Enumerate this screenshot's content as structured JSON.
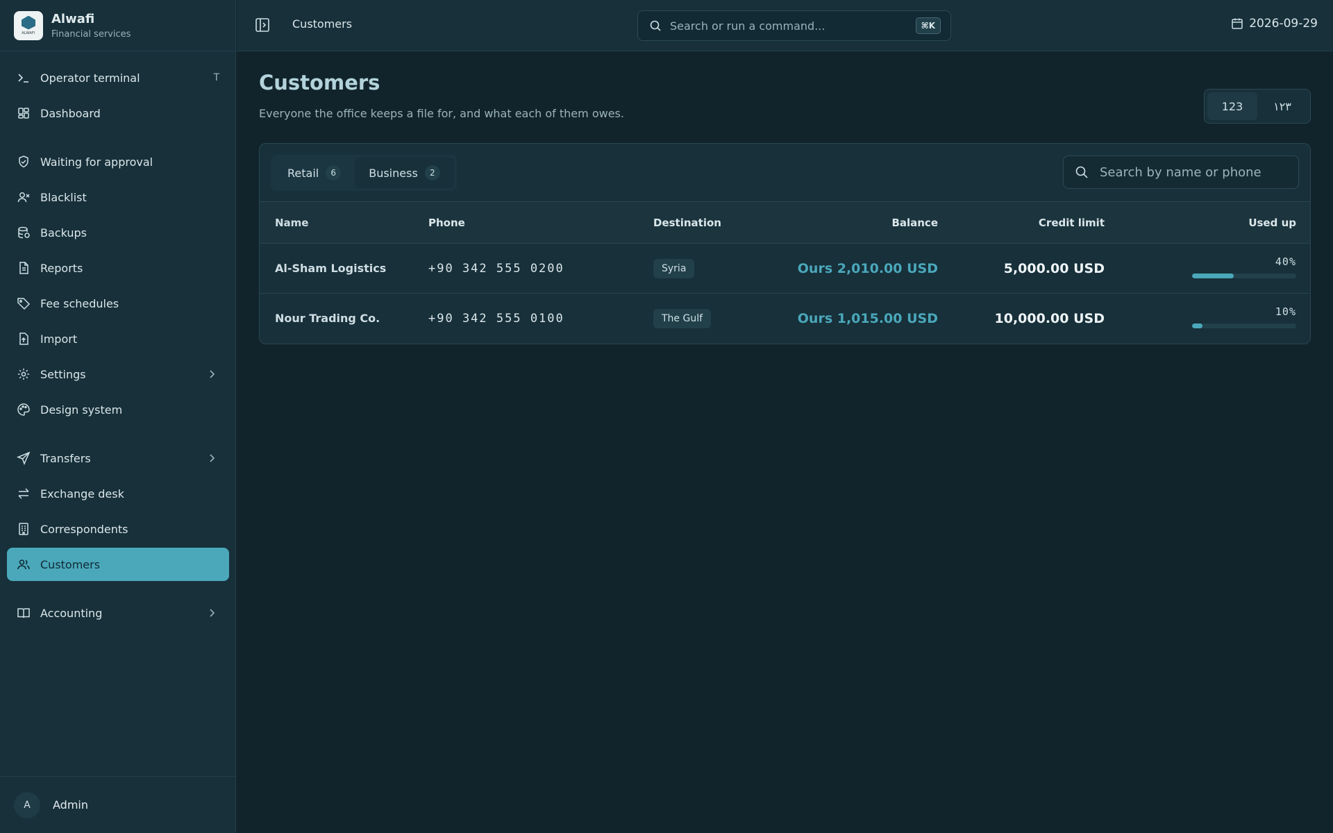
{
  "brand": {
    "name": "Alwafi",
    "subtitle": "Financial services",
    "logo_text": "ALWAFI"
  },
  "sidebar": {
    "items": [
      {
        "label": "Operator terminal",
        "icon": "terminal-icon",
        "shortcut": "T"
      },
      {
        "label": "Dashboard",
        "icon": "dashboard-icon"
      },
      {
        "label": "Waiting for approval",
        "icon": "shield-check-icon"
      },
      {
        "label": "Blacklist",
        "icon": "user-x-icon"
      },
      {
        "label": "Backups",
        "icon": "database-icon"
      },
      {
        "label": "Reports",
        "icon": "document-icon"
      },
      {
        "label": "Fee schedules",
        "icon": "tag-icon"
      },
      {
        "label": "Import",
        "icon": "file-upload-icon"
      },
      {
        "label": "Settings",
        "icon": "gear-icon"
      },
      {
        "label": "Design system",
        "icon": "palette-icon"
      },
      {
        "label": "Transfers",
        "icon": "send-icon"
      },
      {
        "label": "Exchange desk",
        "icon": "exchange-icon"
      },
      {
        "label": "Correspondents",
        "icon": "building-icon"
      },
      {
        "label": "Customers",
        "icon": "users-icon",
        "active": true
      },
      {
        "label": "Accounting",
        "icon": "book-icon"
      }
    ],
    "user": {
      "initial": "A",
      "name": "Admin"
    }
  },
  "topbar": {
    "breadcrumb": "Customers",
    "command_placeholder": "Search or run a command...",
    "command_shortcut": "⌘K",
    "date": "2026-09-29"
  },
  "page": {
    "title": "Customers",
    "subtitle": "Everyone the office keeps a file for, and what each of them owes.",
    "number_format": {
      "latin": "123",
      "arabic": "١٢٣",
      "selected": "latin"
    }
  },
  "table_card": {
    "tabs": [
      {
        "label": "Retail",
        "count": "6"
      },
      {
        "label": "Business",
        "count": "2",
        "active": true
      }
    ],
    "search_placeholder": "Search by name or phone",
    "columns": [
      "Name",
      "Phone",
      "Destination",
      "Balance",
      "Credit limit",
      "Used up"
    ],
    "rows": [
      {
        "name": "Al-Sham Logistics",
        "phone": "+90 342 555 0200",
        "destination": "Syria",
        "balance": "Ours 2,010.00 USD",
        "credit_limit": "5,000.00 USD",
        "used_pct_label": "40%",
        "used_fraction": 0.4
      },
      {
        "name": "Nour Trading Co.",
        "phone": "+90 342 555 0100",
        "destination": "The Gulf",
        "balance": "Ours 1,015.00 USD",
        "credit_limit": "10,000.00 USD",
        "used_pct_label": "10%",
        "used_fraction": 0.1
      }
    ]
  },
  "colors": {
    "background": "#12242b",
    "sidebar": "#17303a",
    "accent": "#4ba8bb",
    "title": "#b3d3db"
  }
}
